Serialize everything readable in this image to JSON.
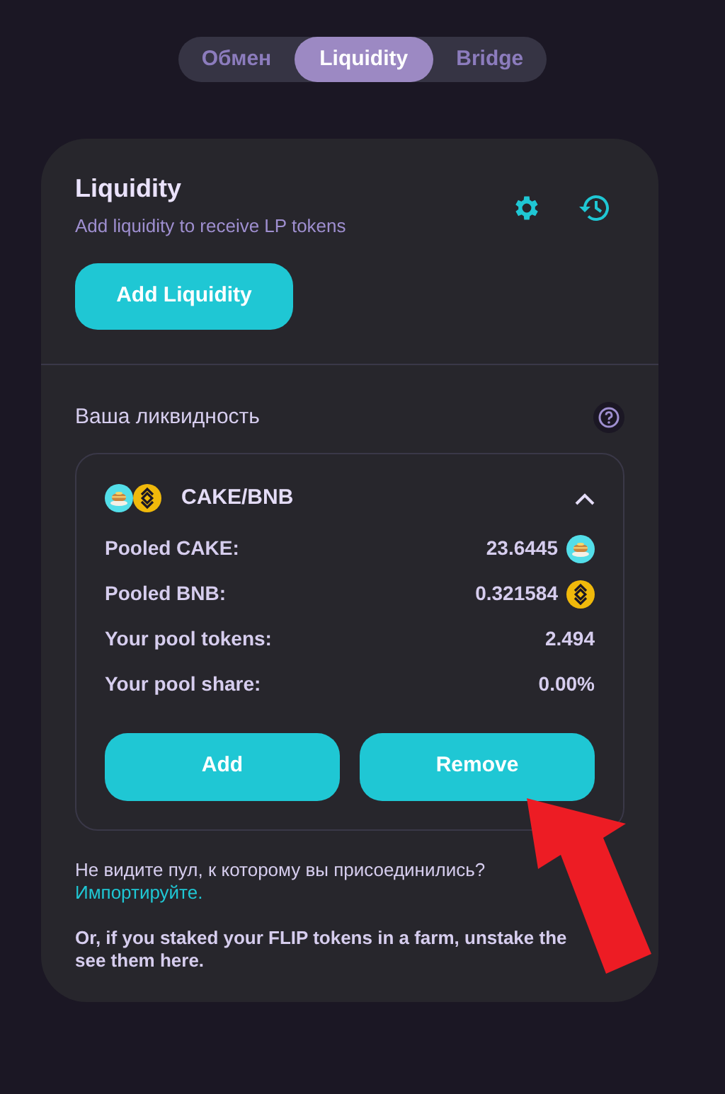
{
  "tabs": [
    {
      "label": "Обмен",
      "selected": false
    },
    {
      "label": "Liquidity",
      "selected": true
    },
    {
      "label": "Bridge",
      "selected": false
    }
  ],
  "card": {
    "title": "Liquidity",
    "subtitle": "Add liquidity to receive LP tokens",
    "add_button": "Add Liquidity"
  },
  "your_liquidity": {
    "heading": "Ваша ликвидность",
    "pair": {
      "name": "CAKE/BNB",
      "expanded": true,
      "rows": [
        {
          "label": "Pooled CAKE:",
          "value": "23.6445",
          "kind": "cake"
        },
        {
          "label": "Pooled BNB:",
          "value": "0.321584",
          "kind": "bnb"
        },
        {
          "label": "Your pool tokens:",
          "value": "2.494"
        },
        {
          "label": "Your pool share:",
          "value": "0.00%"
        }
      ],
      "buttons": [
        "Add",
        "Remove"
      ]
    }
  },
  "footer": {
    "question": "Не видите пул, к которому вы присоединились?",
    "link": "Импортируйте.",
    "note_line_1": "Or, if you staked your FLIP tokens in a farm, unstake the",
    "note_line_2": "see them here."
  }
}
